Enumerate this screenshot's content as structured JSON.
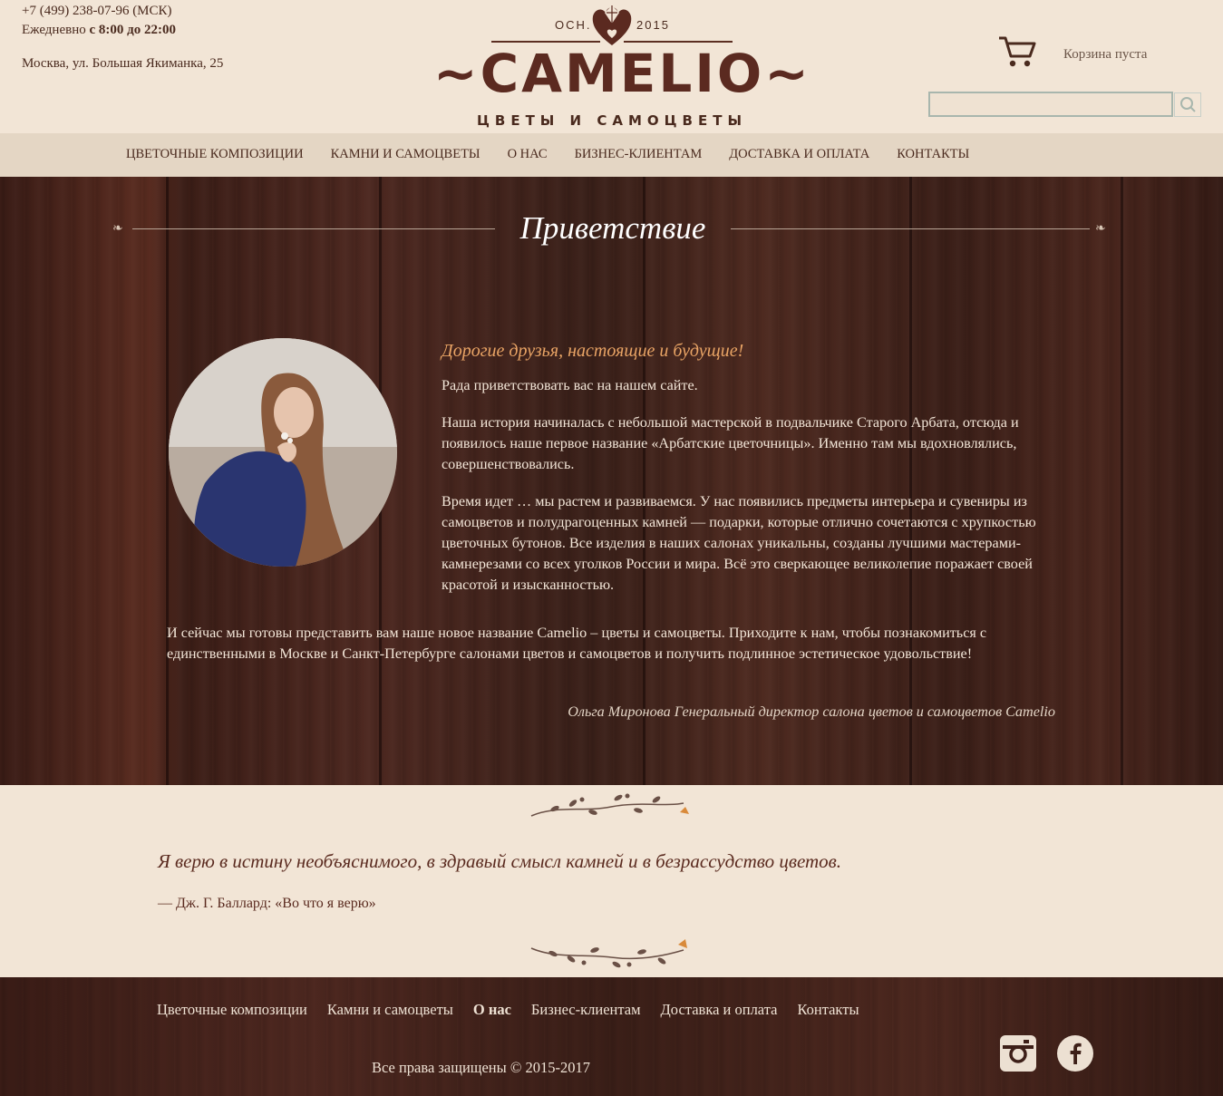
{
  "header": {
    "phone": "+7 (499) 238-07-96 (МСК)",
    "hours_prefix": "Ежедневно ",
    "hours_bold": "с 8:00 до 22:00",
    "address": "Москва, ул. Большая Якиманка, 25",
    "logo": {
      "founded_label": "ОСН.",
      "year": "2015",
      "name": "~CAMELIO~",
      "tagline": "ЦВЕТЫ И САМОЦВЕТЫ"
    },
    "cart_text": "Корзина пуста",
    "search_placeholder": ""
  },
  "nav": {
    "items": [
      "ЦВЕТОЧНЫЕ КОМПОЗИЦИИ",
      "КАМНИ И САМОЦВЕТЫ",
      "О НАС",
      "БИЗНЕС-КЛИЕНТАМ",
      "ДОСТАВКА И ОПЛАТА",
      "КОНТАКТЫ"
    ]
  },
  "welcome": {
    "title": "Приветствие",
    "greeting": "Дорогие друзья, настоящие и будущие!",
    "paragraphs": [
      "Рада приветствовать вас на нашем сайте.",
      "Наша история начиналась с небольшой мастерской в подвальчике Старого Арбата, отсюда и появилось наше первое название «Арбатские цветочницы». Именно там мы вдохновлялись, совершенствовались.",
      "Время идет … мы растем и развиваемся. У нас появились предметы интерьера и сувениры из самоцветов и полудрагоценных камней — подарки, которые отлично сочетаются с хрупкостью цветочных бутонов. Все изделия в наших салонах уникальны, созданы лучшими мастерами-камнерезами со всех уголков России и мира. Всё это сверкающее великолепие поражает своей красотой и изысканностью."
    ],
    "wide_paragraph": "И сейчас мы готовы представить вам наше новое название Camelio – цветы и самоцветы. Приходите к нам, чтобы познакомиться с единственными в Москве и Санкт-Петербурге салонами цветов и самоцветов и получить подлинное эстетическое удовольствие!",
    "signature": "Ольга Миронова Генеральный директор салона цветов и самоцветов Camelio"
  },
  "quote": {
    "text": "Я верю в истину необъяснимого, в здравый смысл камней и в безрассудство цветов.",
    "source": "— Дж. Г. Баллард: «Во что я верю»"
  },
  "footer": {
    "links": [
      "Цветочные композиции",
      "Камни и самоцветы",
      "О нас",
      "Бизнес-клиентам",
      "Доставка и оплата",
      "Контакты"
    ],
    "active_index": 2,
    "copyright": "Все права защищены © 2015-2017",
    "social": [
      "instagram-icon",
      "facebook-icon"
    ]
  },
  "colors": {
    "background": "#f2e5d6",
    "nav_bg": "#e4d6c4",
    "brand_brown": "#5b2a20",
    "accent_orange": "#e9a465",
    "wood_dark": "#3a1c16"
  }
}
